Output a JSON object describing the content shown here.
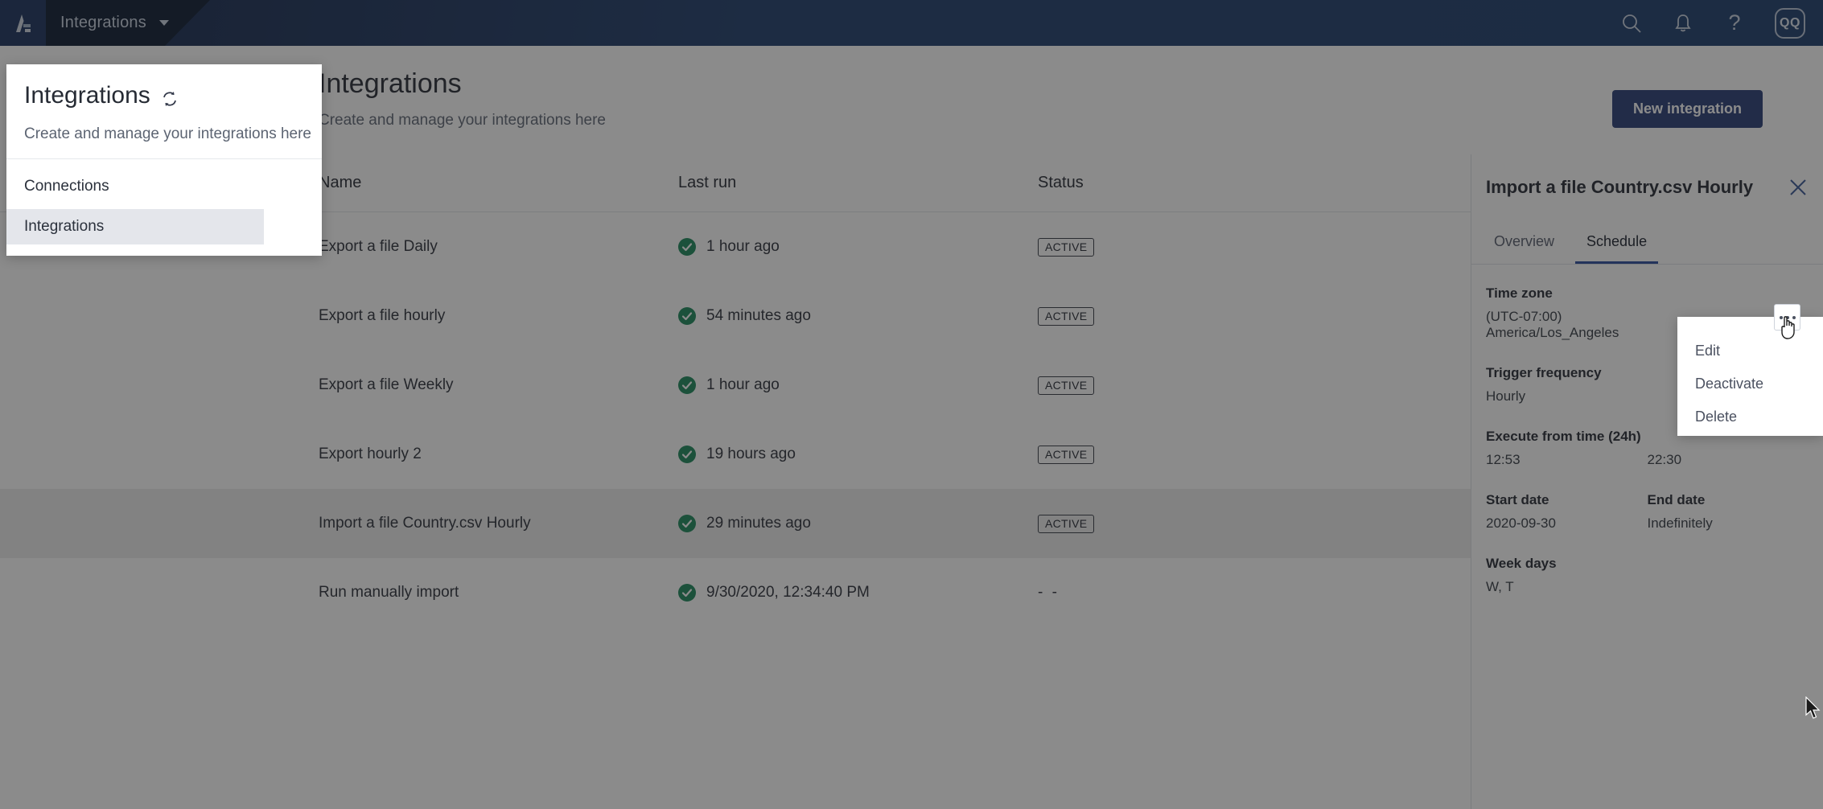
{
  "topnav": {
    "logo_name": "alteryx-logo",
    "menu_label": "Integrations",
    "icons": [
      "search-icon",
      "bell-icon",
      "help-icon"
    ],
    "avatar_initials": "QQ"
  },
  "navpanel": {
    "title": "Integrations",
    "sync_icon": "sync-icon",
    "subtitle": "Create and manage your integrations here",
    "items": [
      {
        "label": "Connections",
        "active": false
      },
      {
        "label": "Integrations",
        "active": true
      }
    ]
  },
  "page": {
    "title": "Integrations",
    "subtitle": "Create and manage your integrations here",
    "new_button": "New integration"
  },
  "table": {
    "columns": [
      "Name",
      "Last run",
      "Status"
    ],
    "rows": [
      {
        "name": "Export a file Daily",
        "last_run": "1 hour ago",
        "status": "ACTIVE",
        "selected": false
      },
      {
        "name": "Export a file hourly",
        "last_run": "54 minutes ago",
        "status": "ACTIVE",
        "selected": false
      },
      {
        "name": "Export a file Weekly",
        "last_run": "1 hour ago",
        "status": "ACTIVE",
        "selected": false
      },
      {
        "name": "Export hourly 2",
        "last_run": "19 hours ago",
        "status": "ACTIVE",
        "selected": false
      },
      {
        "name": "Import a file Country.csv Hourly",
        "last_run": "29 minutes ago",
        "status": "ACTIVE",
        "selected": true
      },
      {
        "name": "Run manually import",
        "last_run": "9/30/2020, 12:34:40 PM",
        "status": "- -",
        "selected": false
      }
    ]
  },
  "detail": {
    "title": "Import a file Country.csv Hourly",
    "close_icon": "close-icon",
    "tabs": [
      {
        "label": "Overview",
        "active": false
      },
      {
        "label": "Schedule",
        "active": true
      }
    ],
    "fields": {
      "time_zone_label": "Time zone",
      "time_zone_value": "(UTC-07:00) America/Los_Angeles",
      "trigger_label": "Trigger frequency",
      "trigger_value": "Hourly",
      "execute_from_label": "Execute from time (24h)",
      "execute_from_value": "12:53",
      "execute_to_value": "22:30",
      "start_date_label": "Start date",
      "start_date_value": "2020-09-30",
      "end_date_label": "End date",
      "end_date_value": "Indefinitely",
      "week_days_label": "Week days",
      "week_days_value": "W, T"
    }
  },
  "context_menu": {
    "trigger_icon": "ellipsis-icon",
    "items": [
      "Edit",
      "Deactivate",
      "Delete"
    ]
  },
  "colors": {
    "nav_dark": "#111e35",
    "nav_blue": "#23406e",
    "primary": "#2c4178",
    "tab_underline": "#2f4f9e",
    "success": "#218a5e",
    "overlay": "rgba(24,24,24,0.50)"
  }
}
